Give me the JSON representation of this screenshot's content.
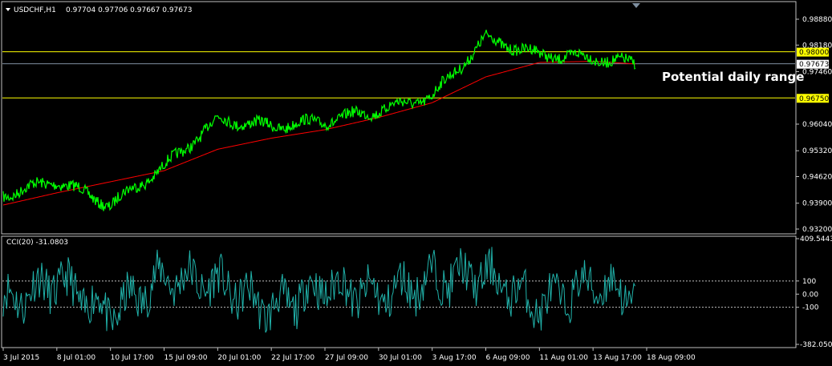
{
  "main_chart": {
    "symbol_label": "USDCHF,H1",
    "ohlc_label": "0.97704 0.97706 0.97667 0.97673",
    "annotation": "Potential daily range",
    "y_ticks": [
      "0.98880",
      "0.98180",
      "0.97460",
      "0.96040",
      "0.95320",
      "0.94620",
      "0.93900",
      "0.93200"
    ],
    "levels": [
      {
        "label": "0.98000",
        "value": 0.98,
        "color": "#ffff00"
      },
      {
        "label": "0.96750",
        "value": 0.9675,
        "color": "#ffff00"
      }
    ],
    "current_price": {
      "label": "0.97673",
      "value": 0.97673,
      "color": "#ffffff"
    }
  },
  "indicator": {
    "label": "CCI(20) -31.0803",
    "y_ticks": [
      "409.5443",
      "100",
      "0.00",
      "-100",
      "-382.0508"
    ],
    "levels": [
      100,
      -100
    ]
  },
  "x_ticks": [
    "3 Jul 2015",
    "8 Jul 01:00",
    "10 Jul 17:00",
    "15 Jul 09:00",
    "20 Jul 01:00",
    "22 Jul 17:00",
    "27 Jul 09:00",
    "30 Jul 01:00",
    "3 Aug 17:00",
    "6 Aug 09:00",
    "11 Aug 01:00",
    "13 Aug 17:00",
    "18 Aug 09:00"
  ],
  "colors": {
    "background": "#000000",
    "price_line": "#00ff00",
    "moving_average": "#ff0000",
    "cci_line": "#20b2aa",
    "level_line": "#ffff00",
    "grid_text": "#ffffff",
    "border": "#c0c0c0"
  },
  "chart_data": [
    {
      "type": "line",
      "name": "USDCHF H1",
      "ylim": [
        0.932,
        0.9888
      ],
      "x": [
        "3 Jul 2015",
        "8 Jul 01:00",
        "10 Jul 17:00",
        "15 Jul 09:00",
        "20 Jul 01:00",
        "22 Jul 17:00",
        "27 Jul 09:00",
        "30 Jul 01:00",
        "3 Aug 17:00",
        "6 Aug 09:00",
        "11 Aug 01:00",
        "13 Aug 17:00",
        "18 Aug 09:00"
      ],
      "series": [
        {
          "values": [
            0.9412,
            0.9451,
            0.9385,
            0.9488,
            0.9617,
            0.9598,
            0.9612,
            0.9641,
            0.9679,
            0.9836,
            0.9792,
            0.9783,
            0.9767
          ]
        },
        {
          "values": [
            0.9385,
            0.9418,
            0.9448,
            0.9478,
            0.9536,
            0.9566,
            0.9589,
            0.9622,
            0.9662,
            0.9732,
            0.9771,
            0.9774,
            0.9767
          ]
        }
      ]
    },
    {
      "type": "line",
      "name": "CCI(20)",
      "ylim": [
        -382.0508,
        409.5443
      ],
      "x": [
        "3 Jul 2015",
        "8 Jul 01:00",
        "10 Jul 17:00",
        "15 Jul 09:00",
        "20 Jul 01:00",
        "22 Jul 17:00",
        "27 Jul 09:00",
        "30 Jul 01:00",
        "3 Aug 17:00",
        "6 Aug 09:00",
        "11 Aug 01:00",
        "13 Aug 17:00",
        "18 Aug 09:00"
      ],
      "series": [
        {
          "values": [
            -120,
            180,
            -280,
            240,
            150,
            -210,
            120,
            -30,
            210,
            260,
            -160,
            150,
            -31.08
          ]
        }
      ]
    }
  ]
}
